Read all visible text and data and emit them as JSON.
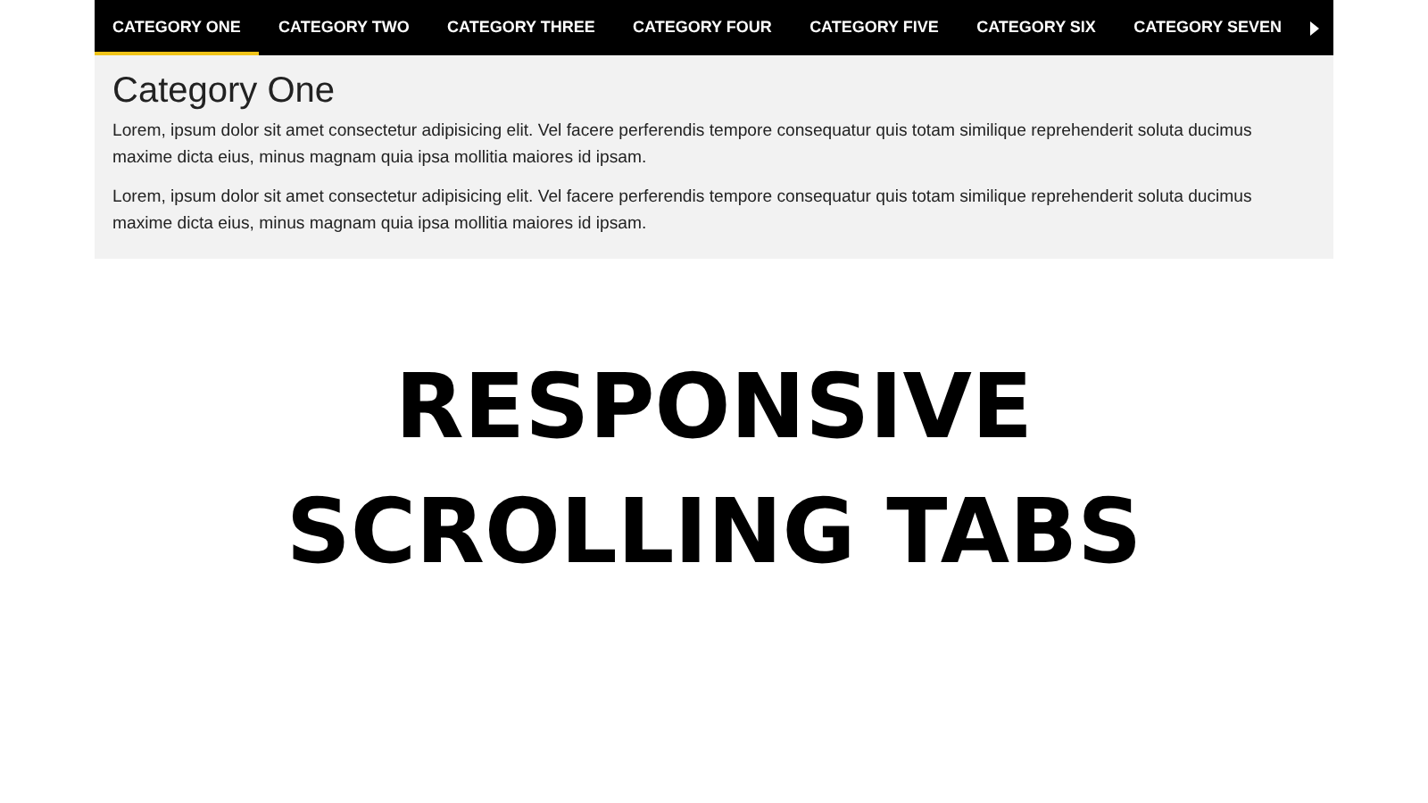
{
  "tabs": [
    {
      "label": "CATEGORY ONE",
      "selected": true
    },
    {
      "label": "CATEGORY TWO",
      "selected": false
    },
    {
      "label": "CATEGORY THREE",
      "selected": false
    },
    {
      "label": "CATEGORY FOUR",
      "selected": false
    },
    {
      "label": "CATEGORY FIVE",
      "selected": false
    },
    {
      "label": "CATEGORY SIX",
      "selected": false
    },
    {
      "label": "CATEGORY SEVEN",
      "selected": false
    }
  ],
  "panel": {
    "heading": "Category One",
    "paragraphs": [
      "Lorem, ipsum dolor sit amet consectetur adipisicing elit. Vel facere perferendis tempore consequatur quis totam similique reprehenderit soluta ducimus maxime dicta eius, minus magnam quia ipsa mollitia maiores id ipsam.",
      "Lorem, ipsum dolor sit amet consectetur adipisicing elit. Vel facere perferendis tempore consequatur quis totam similique reprehenderit soluta ducimus maxime dicta eius, minus magnam quia ipsa mollitia maiores id ipsam."
    ]
  },
  "banner_title": "RESPONSIVE SCROLLING TABS"
}
